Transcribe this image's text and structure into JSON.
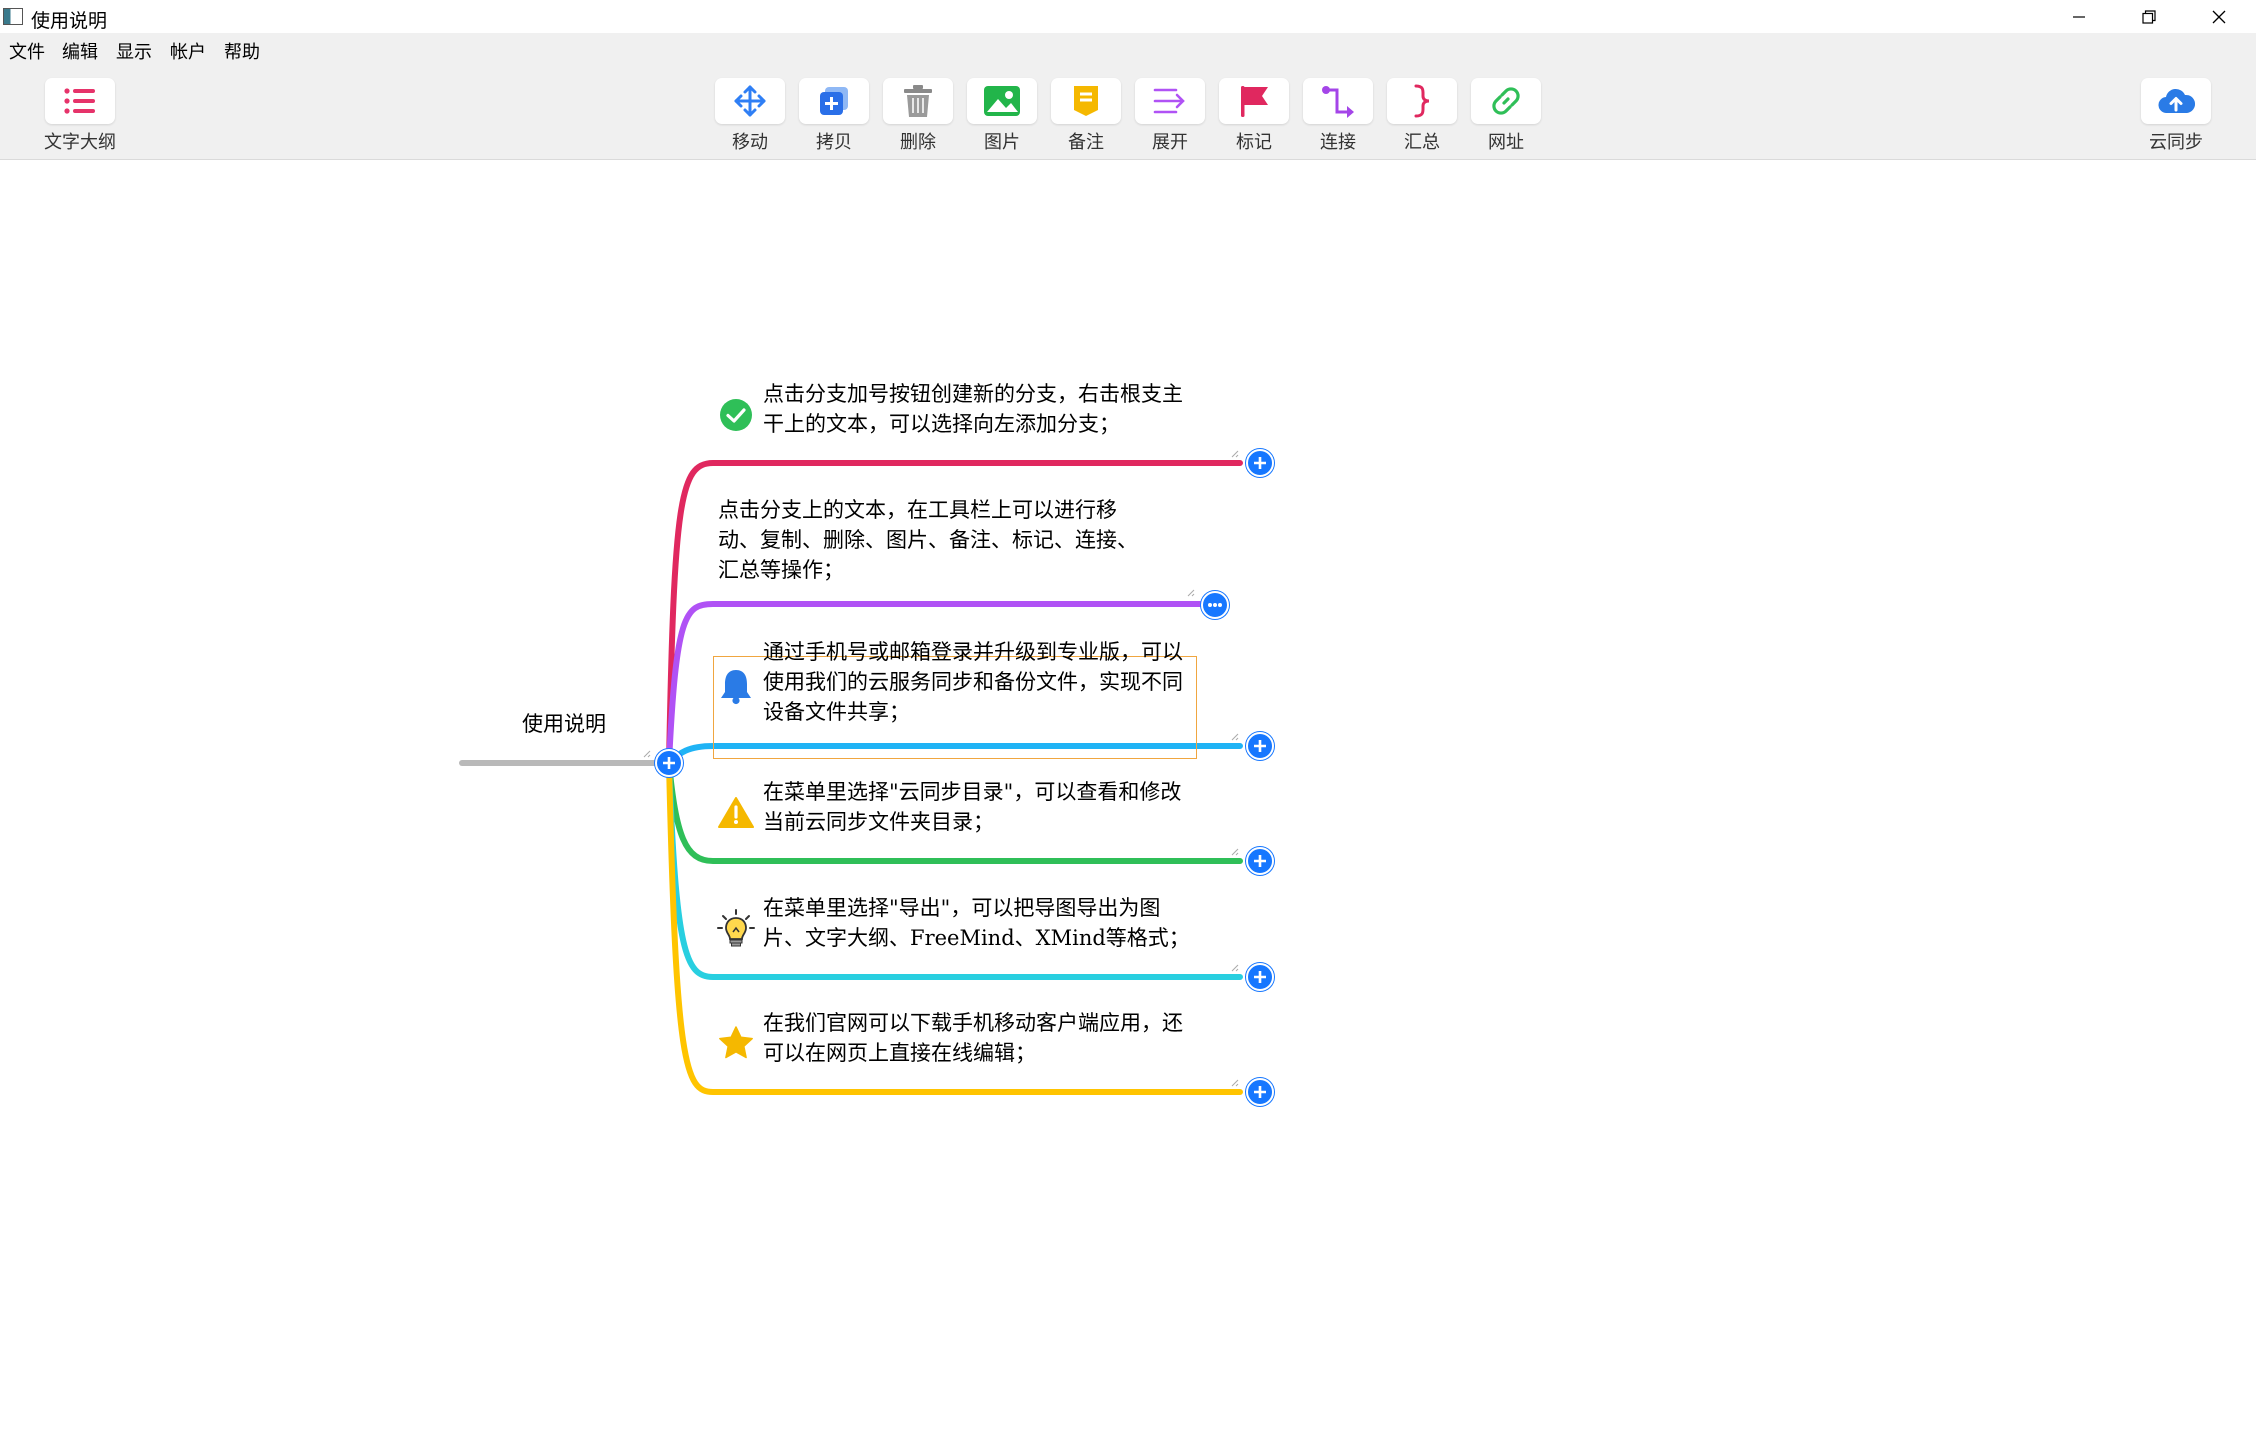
{
  "window": {
    "title": "使用说明"
  },
  "menu": [
    "文件",
    "编辑",
    "显示",
    "帐户",
    "帮助"
  ],
  "toolbar": {
    "outline": "文字大纲",
    "tools": [
      "移动",
      "拷贝",
      "删除",
      "图片",
      "备注",
      "展开",
      "标记",
      "连接",
      "汇总",
      "网址"
    ],
    "sync": "云同步"
  },
  "mindmap": {
    "root": "使用说明",
    "branches": [
      {
        "icon": "check-icon",
        "color": "#e0285f",
        "lines": [
          "点击分支加号按钮创建新的分支，右击根支主",
          "干上的文本，可以选择向左添加分支；"
        ]
      },
      {
        "icon": "",
        "color": "#b052f5",
        "lines": [
          "点击分支上的文本，在工具栏上可以进行移",
          "动、复制、删除、图片、备注、标记、连接、",
          "汇总等操作；"
        ]
      },
      {
        "icon": "bell-icon",
        "color": "#1fb3f5",
        "lines": [
          "通过手机号或邮箱登录并升级到专业版，可以",
          "使用我们的云服务同步和备份文件，实现不同",
          "设备文件共享；"
        ]
      },
      {
        "icon": "warning-icon",
        "color": "#2fbf58",
        "lines": [
          "在菜单里选择\"云同步目录\"，可以查看和修改",
          "当前云同步文件夹目录；"
        ]
      },
      {
        "icon": "lightbulb-icon",
        "color": "#28cfe0",
        "lines": [
          "在菜单里选择\"导出\"，可以把导图导出为图",
          "片、文字大纲、FreeMind、XMind等格式；"
        ]
      },
      {
        "icon": "star-icon",
        "color": "#ffc400",
        "lines": [
          "在我们官网可以下载手机移动客户端应用，还",
          "可以在网页上直接在线编辑；"
        ]
      }
    ]
  }
}
